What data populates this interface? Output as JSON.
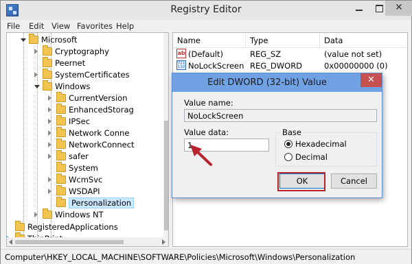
{
  "window": {
    "title": "Registry Editor",
    "close_glyph": "✕"
  },
  "menu": [
    "File",
    "Edit",
    "View",
    "Favorites",
    "Help"
  ],
  "tree": {
    "items": [
      {
        "label": "Microsoft",
        "state": "open"
      },
      {
        "label": "Cryptography",
        "state": "closed"
      },
      {
        "label": "Peernet",
        "state": "none"
      },
      {
        "label": "SystemCertificates",
        "state": "closed"
      },
      {
        "label": "Windows",
        "state": "open"
      },
      {
        "label": "CurrentVersion",
        "state": "closed"
      },
      {
        "label": "EnhancedStorag",
        "state": "closed"
      },
      {
        "label": "IPSec",
        "state": "closed"
      },
      {
        "label": "Network Conne",
        "state": "closed"
      },
      {
        "label": "NetworkConnect",
        "state": "closed"
      },
      {
        "label": "safer",
        "state": "closed"
      },
      {
        "label": "System",
        "state": "none"
      },
      {
        "label": "WcmSvc",
        "state": "closed"
      },
      {
        "label": "WSDAPI",
        "state": "closed"
      },
      {
        "label": "Personalization",
        "state": "selected"
      },
      {
        "label": "Windows NT",
        "state": "closed"
      },
      {
        "label": "RegisteredApplications",
        "state": "none"
      },
      {
        "label": "ThinPrint",
        "state": "closed"
      }
    ]
  },
  "list": {
    "columns": [
      "Name",
      "Type",
      "Data"
    ],
    "rows": [
      {
        "icon": "string-value-icon",
        "icon_glyph": "ab",
        "name": "(Default)",
        "type": "REG_SZ",
        "data": "(value not set)"
      },
      {
        "icon": "dword-value-icon",
        "icon_glyph": "011 110",
        "name": "NoLockScreen",
        "type": "REG_DWORD",
        "data": "0x00000000 (0)"
      }
    ]
  },
  "status": {
    "path": "Computer\\HKEY_LOCAL_MACHINE\\SOFTWARE\\Policies\\Microsoft\\Windows\\Personalization"
  },
  "dialog": {
    "title": "Edit DWORD (32-bit) Value",
    "close_glyph": "✕",
    "value_name_label": "Value name:",
    "value_name": "NoLockScreen",
    "value_data_label": "Value data:",
    "value_data": "1",
    "base_label": "Base",
    "base_options": [
      {
        "label": "Hexadecimal",
        "checked": true
      },
      {
        "label": "Decimal",
        "checked": false
      }
    ],
    "ok_label": "OK",
    "cancel_label": "Cancel",
    "annotation_color": "#b8232e"
  },
  "colors": {
    "dialog_titlebar": "#6fa1e3",
    "dialog_close": "#c75050",
    "selection": "#cce8ff"
  }
}
